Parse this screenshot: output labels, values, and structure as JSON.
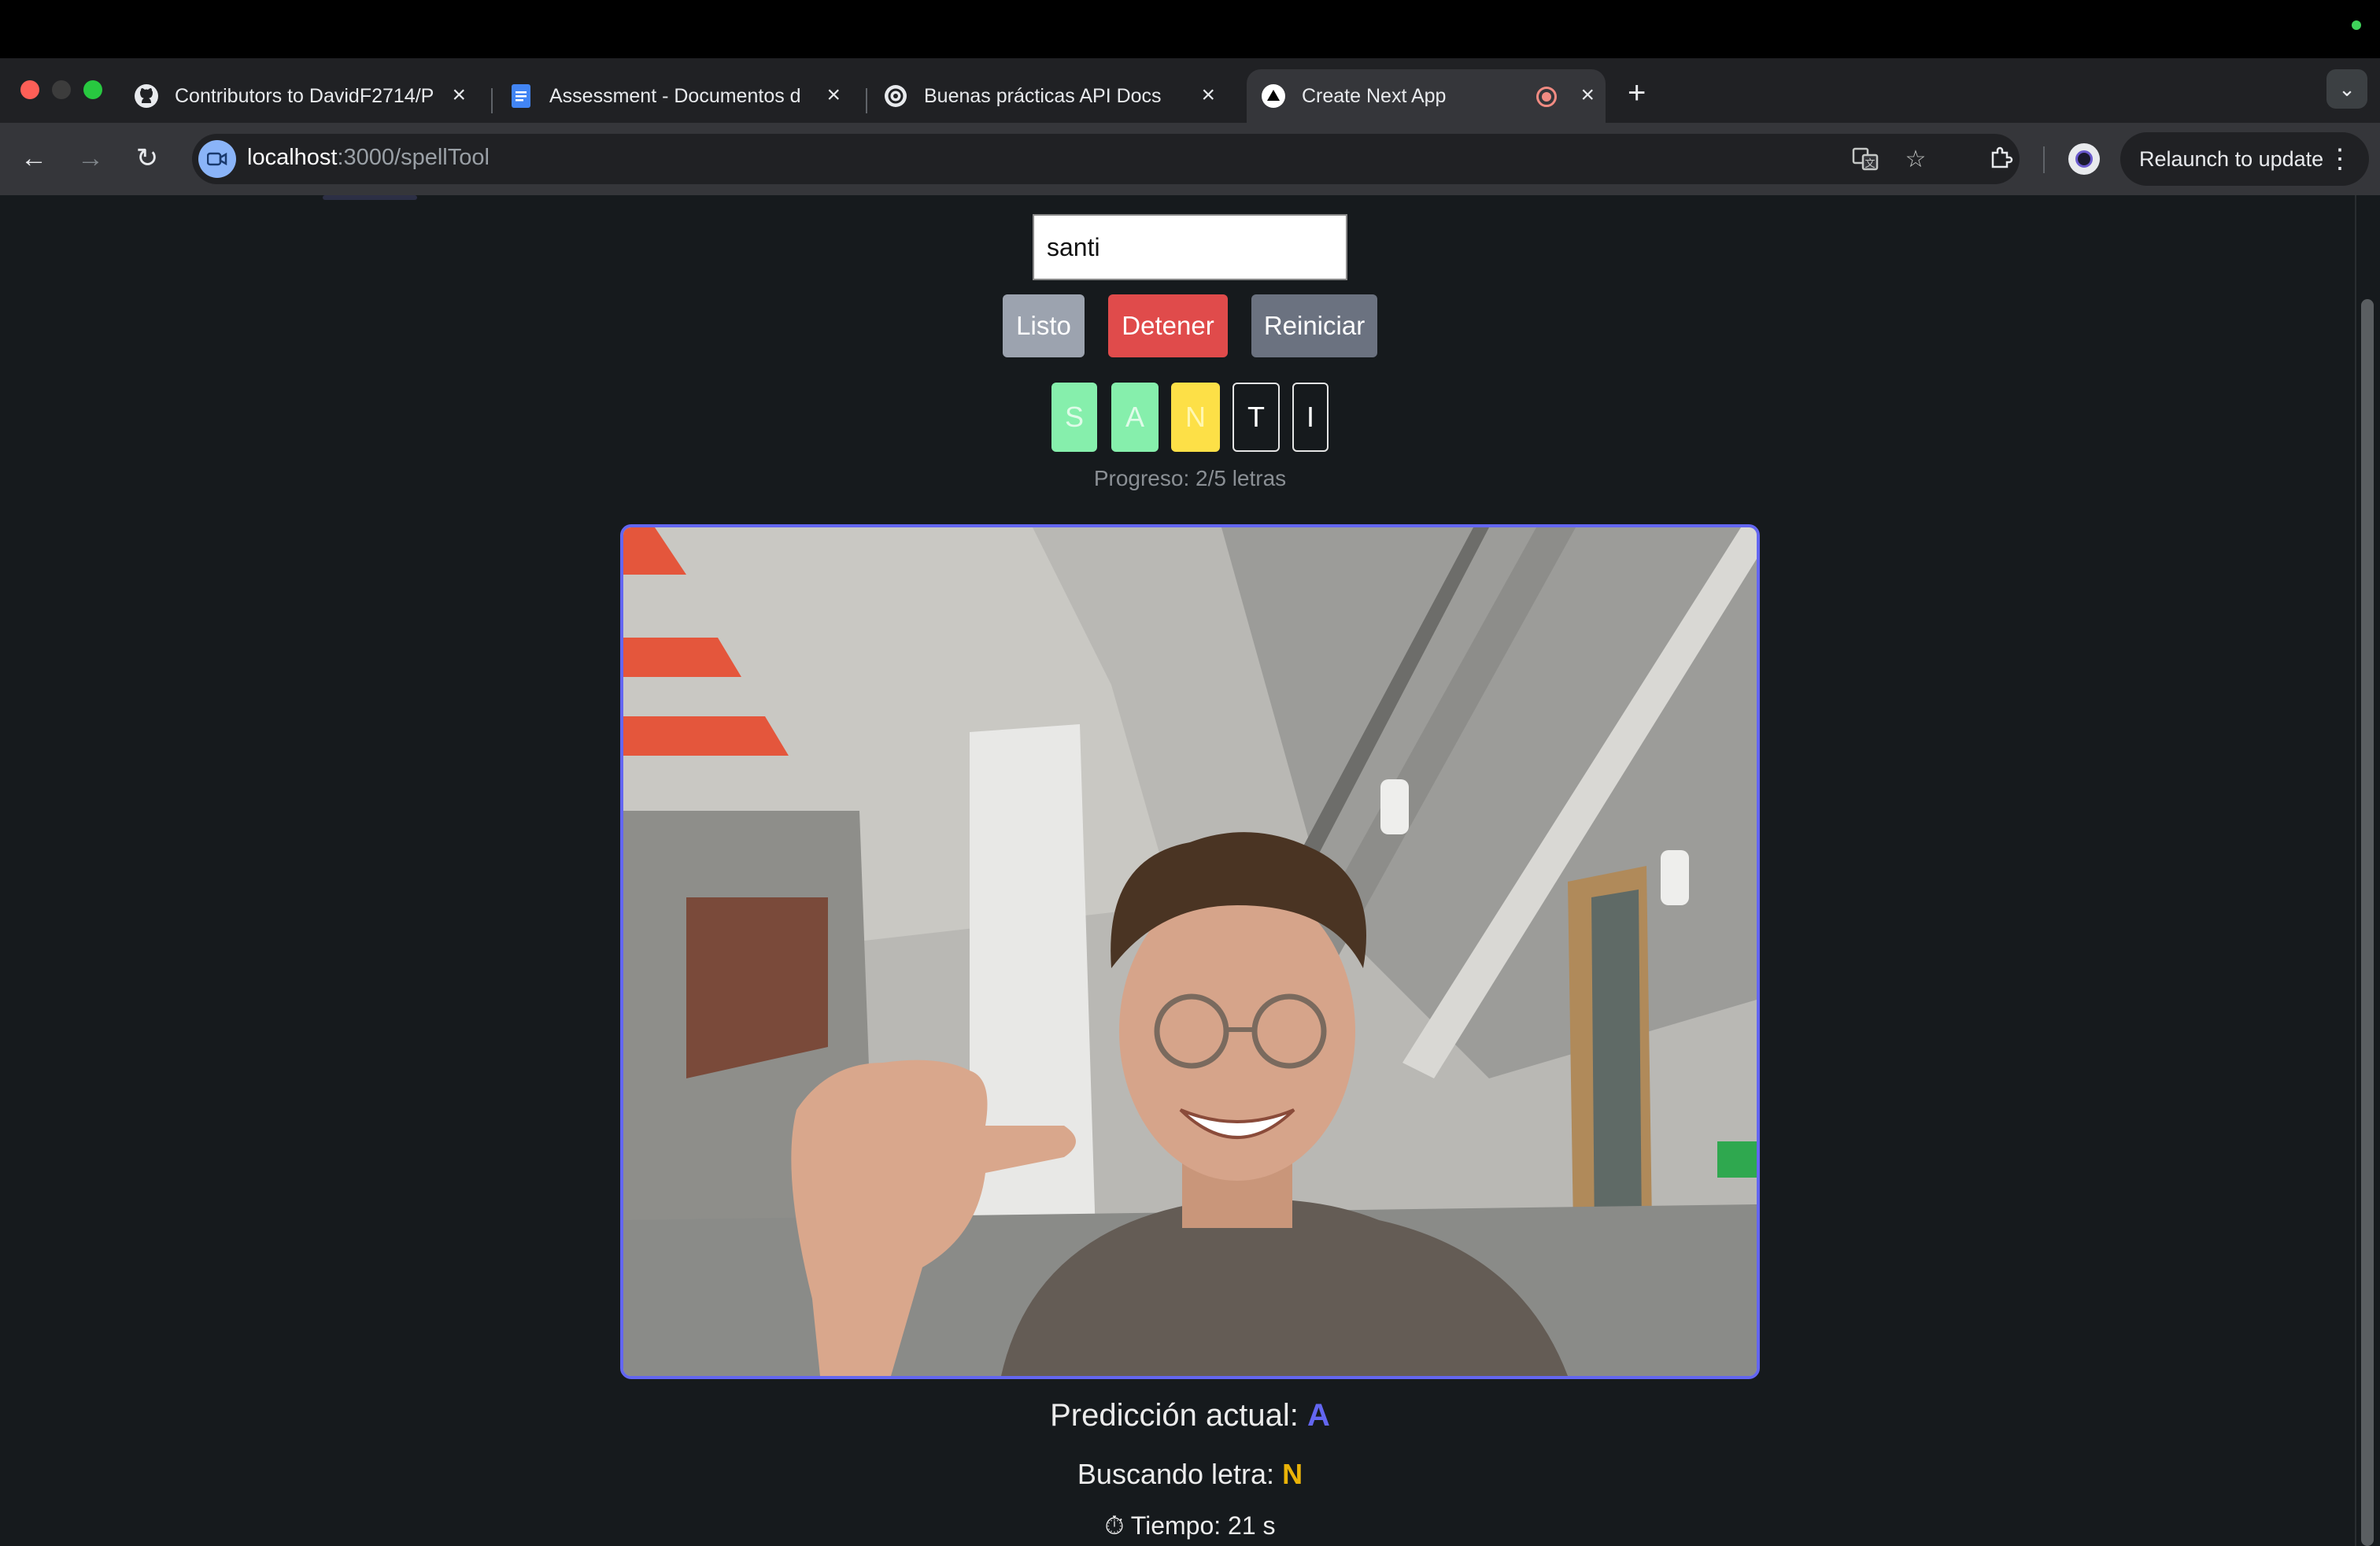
{
  "browser": {
    "tabs": [
      {
        "label": "Contributors to DavidF2714/P",
        "icon": "github-icon",
        "active": false
      },
      {
        "label": "Assessment - Documentos d",
        "icon": "google-docs-icon",
        "active": false
      },
      {
        "label": "Buenas prácticas API Docs",
        "icon": "openai-icon",
        "active": false
      },
      {
        "label": "Create Next App",
        "icon": "nextjs-icon",
        "active": true
      }
    ],
    "url_host": "localhost",
    "url_path": ":3000/spellTool",
    "relaunch_label": "Relaunch to update"
  },
  "app": {
    "input_value": "santi",
    "buttons": {
      "ready": "Listo",
      "stop": "Detener",
      "reset": "Reiniciar"
    },
    "letters": [
      {
        "char": "S",
        "state": "done"
      },
      {
        "char": "A",
        "state": "done"
      },
      {
        "char": "N",
        "state": "current"
      },
      {
        "char": "T",
        "state": "pending"
      },
      {
        "char": "I",
        "state": "pending"
      }
    ],
    "progress_text": "Progreso: 2/5 letras",
    "prediction_label": "Predicción actual:",
    "prediction_value": "A",
    "seeking_label": "Buscando letra:",
    "seeking_value": "N",
    "timer_icon": "⏱",
    "timer_text": "Tiempo: 21 s"
  },
  "colors": {
    "accent": "#6366f1",
    "done": "#86efac",
    "current": "#fde047",
    "stop": "#e04b4b",
    "seek": "#eab308"
  }
}
